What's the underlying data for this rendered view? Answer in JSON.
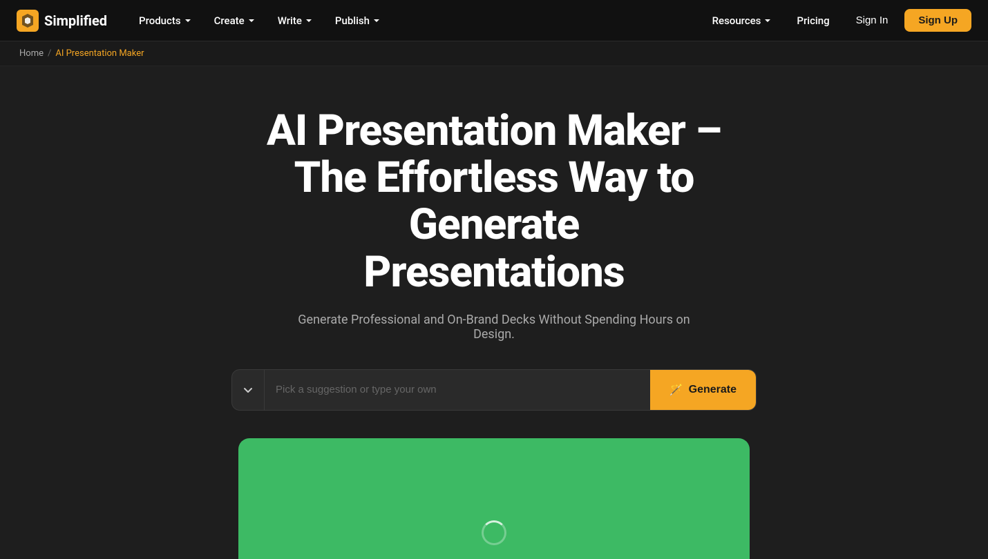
{
  "brand": {
    "name": "Simplified",
    "logo_alt": "Simplified logo"
  },
  "nav": {
    "items": [
      {
        "label": "Products",
        "has_dropdown": true
      },
      {
        "label": "Create",
        "has_dropdown": true
      },
      {
        "label": "Write",
        "has_dropdown": true
      },
      {
        "label": "Publish",
        "has_dropdown": true
      }
    ],
    "right_items": [
      {
        "label": "Resources",
        "has_dropdown": true
      },
      {
        "label": "Pricing",
        "has_dropdown": false
      }
    ],
    "sign_in_label": "Sign In",
    "sign_up_label": "Sign Up"
  },
  "breadcrumb": {
    "home_label": "Home",
    "separator": "/",
    "current_label": "AI Presentation Maker"
  },
  "hero": {
    "title_line1": "AI Presentation Maker –",
    "title_line2": "The Effortless Way to Generate",
    "title_line3": "Presentations",
    "subtitle": "Generate Professional and On-Brand Decks Without Spending Hours on Design.",
    "input_placeholder": "Pick a suggestion or type your own",
    "generate_label": "Generate"
  }
}
